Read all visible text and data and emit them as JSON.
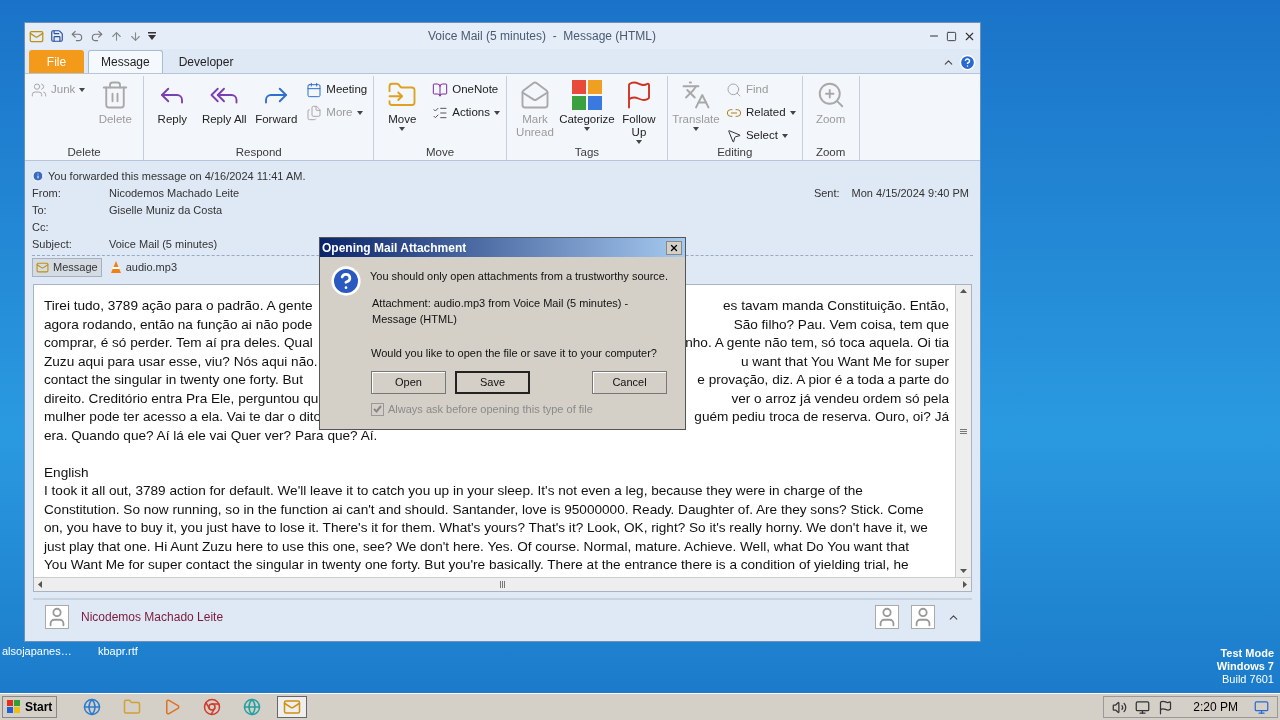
{
  "window": {
    "title": "Voice Mail (5 minutes)  -  Message (HTML)"
  },
  "tabs": [
    {
      "label": "File",
      "kind": "file",
      "selected": false
    },
    {
      "label": "Message",
      "kind": "tab",
      "selected": true
    },
    {
      "label": "Developer",
      "kind": "tab",
      "selected": false
    }
  ],
  "ribbon": [
    {
      "name": "Delete",
      "items": [
        {
          "label": "Junk",
          "kind": "small",
          "disabled": true,
          "dropdown": true
        },
        {
          "label": "Delete",
          "kind": "large",
          "disabled": true,
          "dropdown": false
        }
      ]
    },
    {
      "name": "Respond",
      "items": [
        {
          "label": "Reply",
          "kind": "large",
          "disabled": false,
          "dropdown": false
        },
        {
          "label": "Reply All",
          "kind": "large",
          "disabled": false,
          "dropdown": false
        },
        {
          "label": "Forward",
          "kind": "large",
          "disabled": false,
          "dropdown": false
        },
        {
          "label": "Meeting",
          "kind": "small",
          "disabled": false,
          "dropdown": false
        },
        {
          "label": "More",
          "kind": "small",
          "disabled": true,
          "dropdown": true
        }
      ]
    },
    {
      "name": "Move",
      "items": [
        {
          "label": "Move",
          "kind": "large",
          "disabled": false,
          "dropdown": true
        },
        {
          "label": "OneNote",
          "kind": "small",
          "disabled": false,
          "dropdown": false
        },
        {
          "label": "Actions",
          "kind": "small",
          "disabled": false,
          "dropdown": true
        }
      ]
    },
    {
      "name": "Tags",
      "items": [
        {
          "label": "Mark Unread",
          "kind": "large",
          "disabled": true,
          "dropdown": false
        },
        {
          "label": "Categorize",
          "kind": "large",
          "disabled": false,
          "dropdown": true
        },
        {
          "label": "Follow Up",
          "kind": "large",
          "disabled": false,
          "dropdown": true
        }
      ]
    },
    {
      "name": "Editing",
      "items": [
        {
          "label": "Translate",
          "kind": "large",
          "disabled": true,
          "dropdown": true
        },
        {
          "label": "Find",
          "kind": "small",
          "disabled": true,
          "dropdown": false
        },
        {
          "label": "Related",
          "kind": "small",
          "disabled": false,
          "dropdown": true
        },
        {
          "label": "Select",
          "kind": "small",
          "disabled": false,
          "dropdown": true
        }
      ]
    },
    {
      "name": "Zoom",
      "items": [
        {
          "label": "Zoom",
          "kind": "large",
          "disabled": true,
          "dropdown": false
        }
      ]
    }
  ],
  "info_bar": "You forwarded this message on 4/16/2024 11:41 AM.",
  "header": {
    "fields": [
      {
        "label": "From:",
        "value": "Nicodemos Machado Leite"
      },
      {
        "label": "To:",
        "value": "Giselle Muniz da Costa"
      },
      {
        "label": "Cc:"
      },
      {
        "label": "Subject:",
        "value": "Voice Mail (5 minutes)"
      }
    ],
    "sent_label": "Sent:",
    "sent_value": "Mon 4/15/2024 9:40 PM"
  },
  "attachments": [
    {
      "label": "Message",
      "selected": true
    },
    {
      "label": "audio.mp3",
      "selected": false
    }
  ],
  "body": {
    "covered_lines": [
      [
        "Tirei tudo, 3789 ação para o padrão. A gente",
        "es tavam manda Constituição. Então,"
      ],
      [
        "agora rodando, então na função ai não pode",
        "São filho? Pau. Vem coisa, tem que"
      ],
      [
        "comprar, é só perder. Tem aí pra deles. Qual",
        "nho. A gente não tem, só toca aquela. Oi tia"
      ],
      [
        "Zuzu aqui para usar esse, viu? Nós aqui não.",
        "u want that You Want Me for super"
      ],
      [
        "contact the singular in twenty one forty. But",
        "e provação, diz. A pior é a toda a parte do"
      ],
      [
        "direito. Creditório entra Pra Ele, perguntou qu",
        "ver o arroz já vendeu ordem só pela"
      ],
      [
        "mulher pode ter acesso a ela. Vai te dar o dito",
        "guém pediu troca de reserva. Ouro, oi? Já"
      ]
    ],
    "last_line": "era. Quando que? Aí lá ele vai Quer ver? Para que? Aí.",
    "heading": "English",
    "english_lines": [
      "I took it all out, 3789 action for default. We'll leave it to catch you up in your sleep. It's not even a leg, because they were in charge of the",
      "Constitution. So now running, so in the function ai can't and should. Santander, love is 95000000. Ready. Daughter of. Are they sons? Stick. Come",
      "on, you have to buy it, you just have to lose it. There's it for them. What's yours? That's it? Look, OK, right? So it's really horny. We don't have it, we",
      "just play that one. Hi Aunt Zuzu here to use this one, see? We don't here. Yes. Of course. Normal, mature. Achieve. Well, what Do You want that",
      "You Want Me for super contact the singular in twenty one forty. But you're basically. There at the entrance there is a condition of yielding trial, he"
    ]
  },
  "people_pane": {
    "name": "Nicodemos Machado Leite"
  },
  "dialog": {
    "title": "Opening Mail Attachment",
    "warning": "You should only open attachments from a trustworthy source.",
    "attachment": "Attachment: audio.mp3 from Voice Mail (5 minutes) - Message (HTML)",
    "question": "Would you like to open the file or save it to your computer?",
    "buttons": [
      {
        "label": "Open",
        "selected": false
      },
      {
        "label": "Save",
        "selected": true
      },
      {
        "label": "Cancel",
        "selected": false
      }
    ],
    "checkbox": {
      "label": "Always ask before opening this type of file",
      "checked": true,
      "disabled": true
    }
  },
  "desktop_icons": [
    "alsojapanes…",
    "kbapr.rtf"
  ],
  "os_notice": [
    "Test Mode",
    "Windows 7",
    "Build 7601"
  ],
  "taskbar": {
    "start": "Start",
    "apps": [
      {
        "selected": false
      },
      {
        "selected": false
      },
      {
        "selected": false
      },
      {
        "selected": false
      },
      {
        "selected": false
      },
      {
        "selected": true
      }
    ],
    "time": "2:20 PM"
  }
}
